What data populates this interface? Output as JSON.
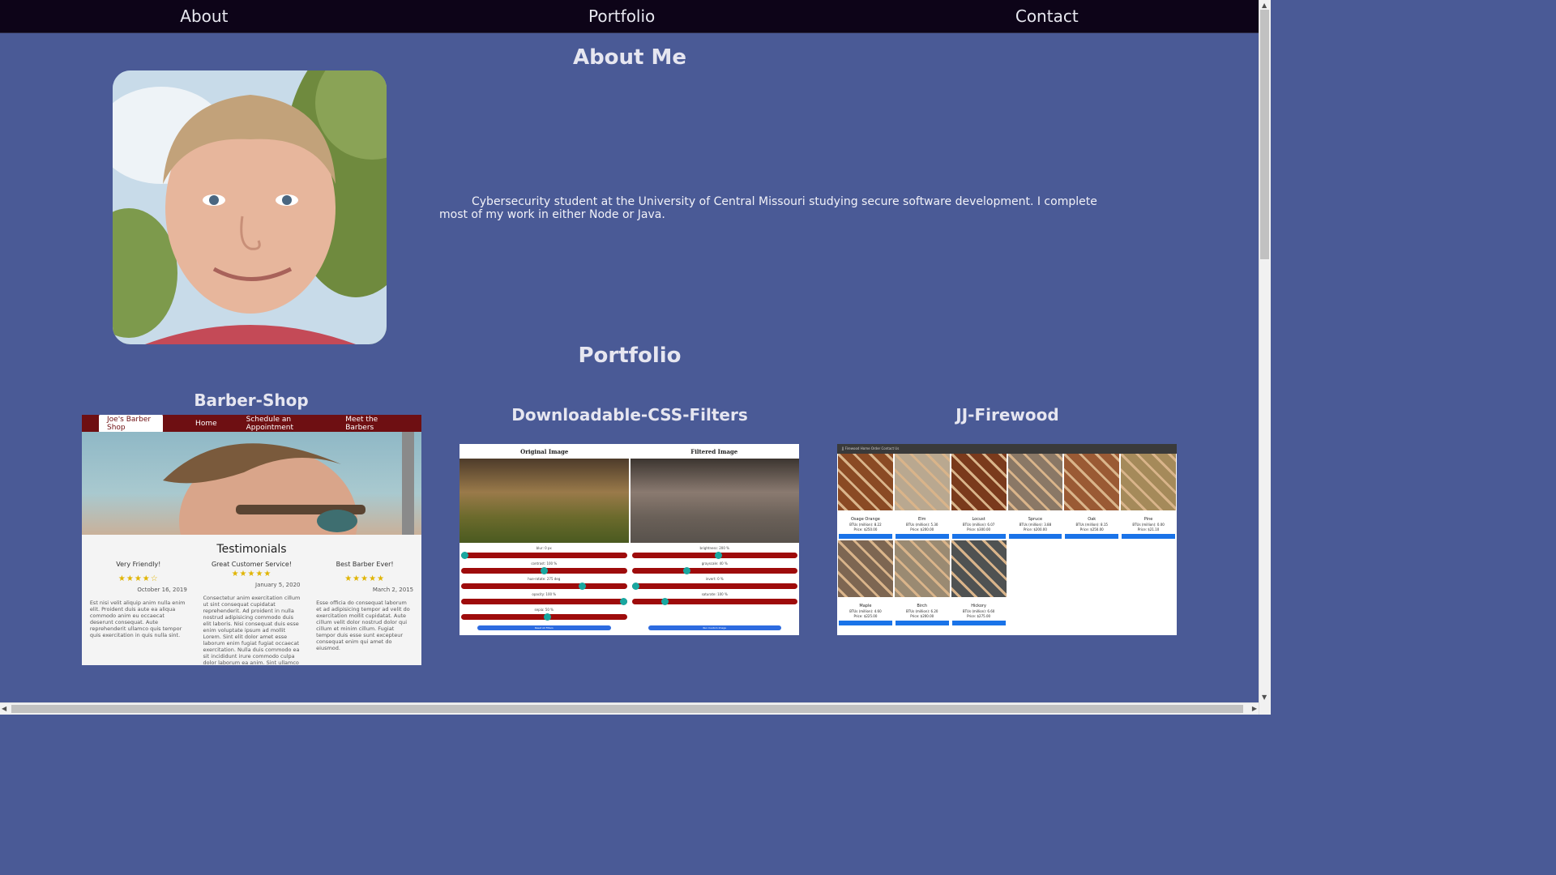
{
  "nav": {
    "items": [
      {
        "label": "About"
      },
      {
        "label": "Portfolio"
      },
      {
        "label": "Contact"
      }
    ]
  },
  "about": {
    "title": "About Me",
    "bio": "Cybersecurity student at the University of Central Missouri studying secure software development. I complete most of my work in either Node or Java."
  },
  "portfolio": {
    "title": "Portfolio",
    "projects": [
      {
        "title": "Barber-Shop",
        "screenshot": {
          "brand": "Joe's Barber Shop",
          "links": [
            "Home",
            "Schedule an Appointment",
            "Meet the Barbers"
          ],
          "heading": "Testimonials",
          "testimonials": [
            {
              "title": "Very Friendly!",
              "stars": "★★★★☆",
              "date": "October 16, 2019",
              "text": "Est nisi velit aliquip anim nulla enim elit. Proident duis aute ea aliqua commodo anim eu occaecat deserunt consequat. Aute reprehenderit ullamco quis tempor quis exercitation in quis nulla sint."
            },
            {
              "title": "Great Customer Service!",
              "stars": "★★★★★",
              "date": "January 5, 2020",
              "text": "Consectetur anim exercitation cillum ut sint consequat cupidatat reprehenderit. Ad proident in nulla nostrud adipisicing commodo duis elit laboris. Nisi consequat duis esse enim voluptate ipsum ad mollit Lorem. Sint elit dolor amet esse laborum enim fugiat fugiat occaecat exercitation. Nulla duis commodo ea sit incididunt irure commodo culpa dolor laborum ea anim. Sint ullamco duis sint consequat."
            },
            {
              "title": "Best Barber Ever!",
              "stars": "★★★★★",
              "date": "March 2, 2015",
              "text": "Esse officia do consequat laborum et ad adipisicing tempor ad velit do exercitation mollit cupidatat. Aute cillum velit dolor nostrud dolor qui cillum et minim cillum. Fugiat tempor duis esse sunt excepteur consequat enim qui amet do eiusmod."
            }
          ]
        }
      },
      {
        "title": "Downloadable-CSS-Filters",
        "screenshot": {
          "left_header": "Original Image",
          "right_header": "Filtered Image",
          "left_sliders": [
            {
              "label": "blur: 0 px",
              "pos": 0.02
            },
            {
              "label": "contrast: 100 %",
              "pos": 0.5
            },
            {
              "label": "hue-rotate: 275 deg",
              "pos": 0.73
            },
            {
              "label": "opacity: 100 %",
              "pos": 0.98
            },
            {
              "label": "sepia: 50 %",
              "pos": 0.52
            }
          ],
          "right_sliders": [
            {
              "label": "brightness: 200 %",
              "pos": 0.52
            },
            {
              "label": "grayscale: 40 %",
              "pos": 0.33
            },
            {
              "label": "invert: 0 %",
              "pos": 0.02
            },
            {
              "label": "saturate: 100 %",
              "pos": 0.2
            }
          ],
          "left_button": "Reset All Filters",
          "right_button": "Run Custom Image"
        }
      },
      {
        "title": "JJ-Firewood",
        "screenshot": {
          "nav": "JJ Firewood   Home   Order   Contact Us",
          "items": [
            {
              "name": "Osage Orange",
              "btu": "BTUs (million): 8.22",
              "price": "Price: $250.00"
            },
            {
              "name": "Elm",
              "btu": "BTUs (million): 5.30",
              "price": "Price: $200.00"
            },
            {
              "name": "Locust",
              "btu": "BTUs (million): 6.07",
              "price": "Price: $300.00"
            },
            {
              "name": "Spruce",
              "btu": "BTUs (million): 3.88",
              "price": "Price: $200.00"
            },
            {
              "name": "Oak",
              "btu": "BTUs (million): 8.15",
              "price": "Price: $250.00"
            },
            {
              "name": "Pine",
              "btu": "BTUs (million): 0.00",
              "price": "Price: $21.10"
            },
            {
              "name": "Maple",
              "btu": "BTUs (million): 4.60",
              "price": "Price: $225.00"
            },
            {
              "name": "Birch",
              "btu": "BTUs (million): 6.20",
              "price": "Price: $200.00"
            },
            {
              "name": "Hickory",
              "btu": "BTUs (million): 6.60",
              "price": "Price: $275.00"
            }
          ]
        }
      }
    ]
  },
  "colors": {
    "background": "#4a5a96",
    "navbar": "#0d0418",
    "barber_accent": "#6e0f12",
    "slider_track": "#9e0b0b",
    "slider_knob": "#19a7a0",
    "button_blue": "#2d6be0"
  }
}
